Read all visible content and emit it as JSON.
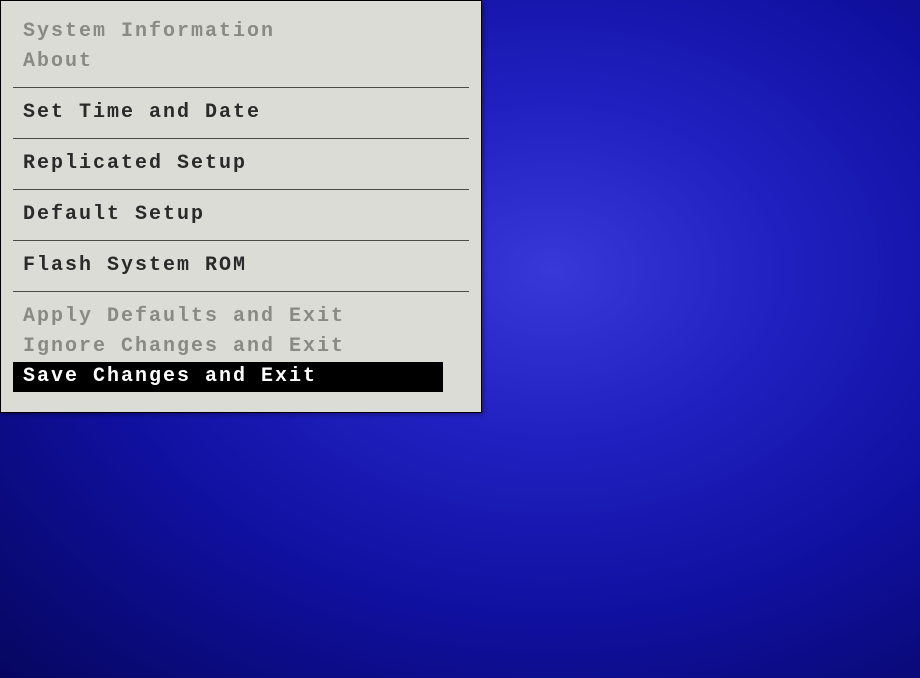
{
  "menu": {
    "groups": [
      {
        "items": [
          {
            "label": "System Information",
            "disabled": true,
            "selected": false
          },
          {
            "label": "About",
            "disabled": true,
            "selected": false
          }
        ]
      },
      {
        "items": [
          {
            "label": "Set Time and Date",
            "disabled": false,
            "selected": false
          }
        ]
      },
      {
        "items": [
          {
            "label": "Replicated Setup",
            "disabled": false,
            "selected": false
          }
        ]
      },
      {
        "items": [
          {
            "label": "Default Setup",
            "disabled": false,
            "selected": false
          }
        ]
      },
      {
        "items": [
          {
            "label": "Flash System ROM",
            "disabled": false,
            "selected": false
          }
        ]
      },
      {
        "items": [
          {
            "label": "Apply Defaults and Exit",
            "disabled": true,
            "selected": false
          },
          {
            "label": "Ignore Changes and Exit",
            "disabled": true,
            "selected": false
          },
          {
            "label": "Save Changes and Exit",
            "disabled": false,
            "selected": true
          }
        ]
      }
    ]
  }
}
